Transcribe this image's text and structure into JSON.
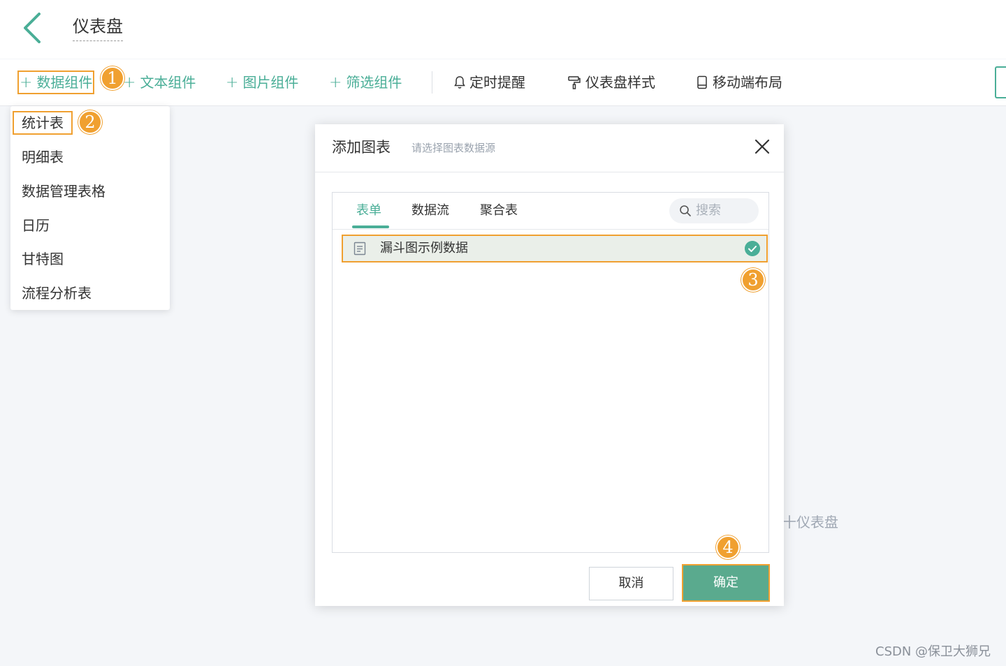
{
  "header": {
    "title": "仪表盘"
  },
  "toolbar": {
    "data_widget": "数据组件",
    "text_widget": "文本组件",
    "image_widget": "图片组件",
    "filter_widget": "筛选组件",
    "reminder": "定时提醒",
    "dashboard_style": "仪表盘样式",
    "mobile_layout": "移动端布局"
  },
  "steps": [
    "1",
    "2",
    "3",
    "4"
  ],
  "dropdown": {
    "items": [
      "统计表",
      "明细表",
      "数据管理表格",
      "日历",
      "甘特图",
      "流程分析表"
    ]
  },
  "background_hint": "十仪表盘",
  "modal": {
    "title": "添加图表",
    "subtitle": "请选择图表数据源",
    "tabs": [
      "表单",
      "数据流",
      "聚合表"
    ],
    "active_tab": "表单",
    "search_placeholder": "搜索",
    "rows": [
      {
        "label": "漏斗图示例数据",
        "selected": true
      }
    ],
    "cancel": "取消",
    "confirm": "确定"
  },
  "colors": {
    "accent": "#4aae97",
    "highlight": "#f0a030",
    "confirm_bg": "#5aaa8e"
  },
  "icons": [
    "back-arrow-icon",
    "plus-icon",
    "bell-icon",
    "paint-roller-icon",
    "mobile-icon",
    "close-icon",
    "search-icon",
    "document-icon",
    "check-circle-icon"
  ],
  "watermark": "CSDN @保卫大狮兄"
}
